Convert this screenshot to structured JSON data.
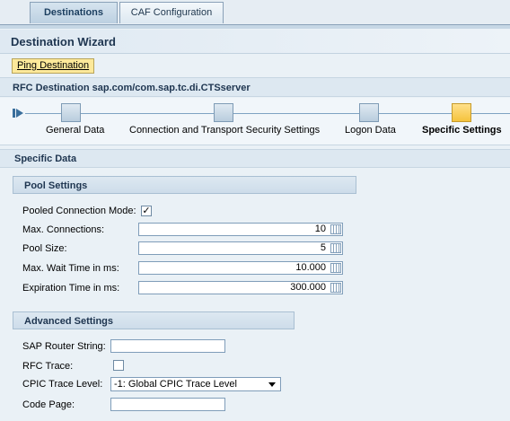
{
  "tabs": [
    {
      "label": "Destinations"
    },
    {
      "label": "CAF Configuration"
    }
  ],
  "wizard": {
    "title": "Destination Wizard"
  },
  "ping_button": {
    "label": "Ping Destination"
  },
  "rfc_destination": {
    "title": "RFC Destination sap.com/com.sap.tc.di.CTSserver"
  },
  "roadmap": {
    "steps": [
      {
        "label": "General Data"
      },
      {
        "label": "Connection and Transport Security Settings"
      },
      {
        "label": "Logon Data"
      },
      {
        "label": "Specific Settings"
      }
    ],
    "current_step": 4
  },
  "section": {
    "title": "Specific Data"
  },
  "pool_settings": {
    "title": "Pool Settings",
    "pooled_mode": {
      "label": "Pooled Connection Mode:",
      "checked": true,
      "mark": "✓"
    },
    "max_connections": {
      "label": "Max. Connections:",
      "value": "10"
    },
    "pool_size": {
      "label": "Pool Size:",
      "value": "5"
    },
    "max_wait": {
      "label": "Max. Wait Time in ms:",
      "value": "10.000"
    },
    "expiration": {
      "label": "Expiration Time in ms:",
      "value": "300.000"
    }
  },
  "advanced_settings": {
    "title": "Advanced Settings",
    "router_string": {
      "label": "SAP Router String:",
      "value": ""
    },
    "rfc_trace": {
      "label": "RFC Trace:",
      "checked": false
    },
    "cpic_trace": {
      "label": "CPIC Trace Level:",
      "value": "-1: Global CPIC Trace Level"
    },
    "code_page": {
      "label": "Code Page:",
      "value": ""
    }
  },
  "colors": {
    "accent": "#1e3550",
    "current_step": "#f5c33d",
    "button": "#fde99a"
  }
}
